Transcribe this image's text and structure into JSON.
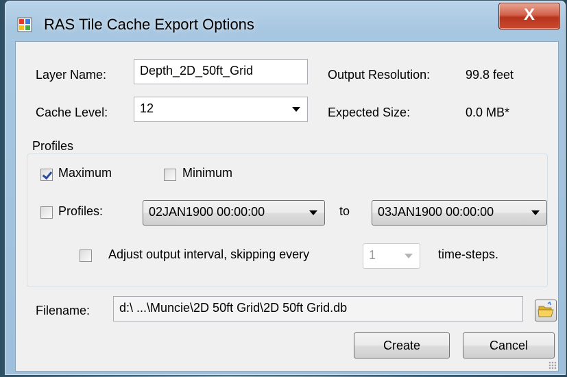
{
  "window": {
    "title": "RAS Tile Cache Export Options",
    "close_label": "X"
  },
  "layer": {
    "label": "Layer Name:",
    "value": "Depth_2D_50ft_Grid"
  },
  "output_resolution": {
    "label": "Output Resolution:",
    "value": "99.8 feet"
  },
  "cache_level": {
    "label": "Cache Level:",
    "value": "12"
  },
  "expected_size": {
    "label": "Expected Size:",
    "value": "0.0 MB*"
  },
  "profiles": {
    "group_label": "Profiles",
    "maximum": {
      "label": "Maximum",
      "checked": true
    },
    "minimum": {
      "label": "Minimum",
      "checked": false
    },
    "profiles_check": {
      "label": "Profiles:",
      "checked": false
    },
    "from_value": "02JAN1900 00:00:00",
    "to_label": "to",
    "to_value": "03JAN1900 00:00:00",
    "adjust": {
      "label": "Adjust output interval, skipping every",
      "checked": false,
      "interval_value": "1",
      "suffix": "time-steps."
    }
  },
  "filename": {
    "label": "Filename:",
    "value": "d:\\ ...\\Muncie\\2D 50ft Grid\\2D 50ft Grid.db"
  },
  "buttons": {
    "create": "Create",
    "cancel": "Cancel"
  },
  "icons": {
    "app": "app-icon",
    "close": "close-icon",
    "folder": "open-folder-icon"
  },
  "colors": {
    "accent": "#2a4a9e",
    "close": "#c94a30"
  }
}
